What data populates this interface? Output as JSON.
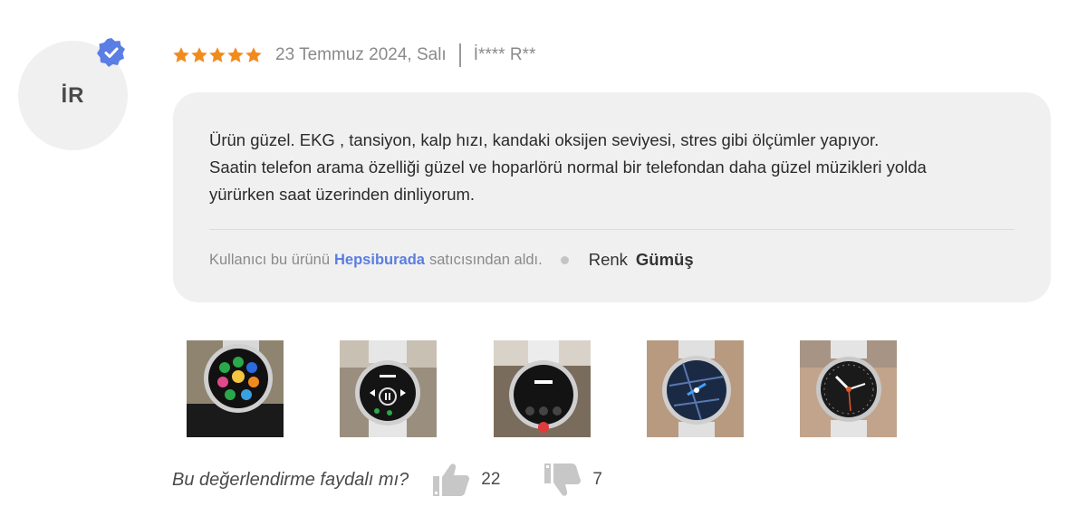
{
  "reviewer": {
    "initials": "İR",
    "name": "İ**** R**",
    "verified_icon": "verified-badge-icon",
    "badge_color": "#5b7ee5"
  },
  "review": {
    "rating": 5,
    "star_color": "#f28b1e",
    "date": "23 Temmuz 2024, Salı",
    "text_lines": [
      "Ürün güzel. EKG , tansiyon, kalp hızı, kandaki oksijen seviyesi, stres gibi ölçümler yapıyor.",
      "Saatin telefon arama özelliği güzel ve  hoparlörü normal bir telefondan daha güzel müzikleri yolda",
      "yürürken saat üzerinden dinliyorum."
    ],
    "purchase_prefix": "Kullanıcı bu ürünü",
    "seller": "Hepsiburada",
    "purchase_suffix": "satıcısından aldı.",
    "attribute_name": "Renk",
    "attribute_value": "Gümüş"
  },
  "photos": [
    {
      "label": "watch-photo-apps"
    },
    {
      "label": "watch-photo-music"
    },
    {
      "label": "watch-photo-call"
    },
    {
      "label": "watch-photo-map"
    },
    {
      "label": "watch-photo-watchface"
    }
  ],
  "helpful": {
    "question": "Bu değerlendirme faydalı mı?",
    "likes": "22",
    "dislikes": "7",
    "like_icon": "thumbs-up-icon",
    "dislike_icon": "thumbs-down-icon"
  }
}
